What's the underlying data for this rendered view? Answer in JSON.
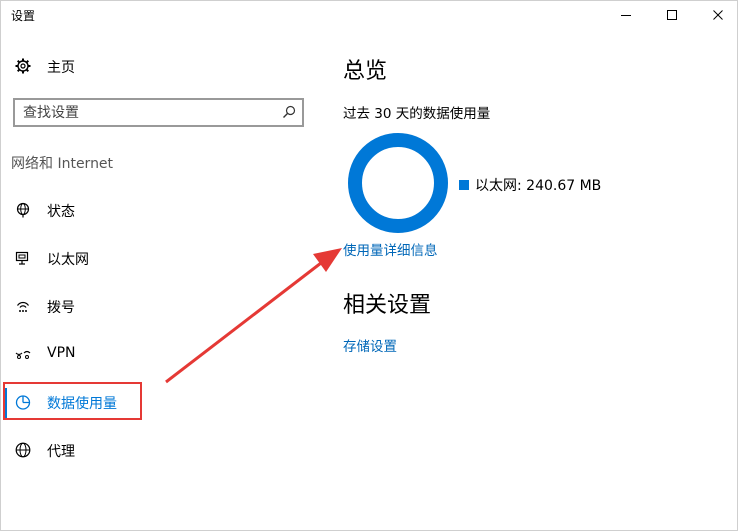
{
  "window": {
    "title": "设置"
  },
  "sidebar": {
    "home_label": "主页",
    "search_placeholder": "查找设置",
    "section_title": "网络和 Internet",
    "items": [
      {
        "label": "状态",
        "icon": "globe-status-icon"
      },
      {
        "label": "以太网",
        "icon": "ethernet-icon"
      },
      {
        "label": "拨号",
        "icon": "dialup-icon"
      },
      {
        "label": "VPN",
        "icon": "vpn-icon"
      },
      {
        "label": "数据使用量",
        "icon": "pie-chart-icon",
        "selected": true
      },
      {
        "label": "代理",
        "icon": "globe-icon"
      }
    ]
  },
  "main": {
    "overview_title": "总览",
    "period_label": "过去 30 天的数据使用量",
    "legend_entry": "以太网: 240.67 MB",
    "usage_share": 1.0,
    "details_link": "使用量详细信息",
    "related_title": "相关设置",
    "storage_link": "存储设置"
  },
  "colors": {
    "accent": "#0078d7",
    "link": "#0067b8",
    "annotation": "#e53935"
  }
}
